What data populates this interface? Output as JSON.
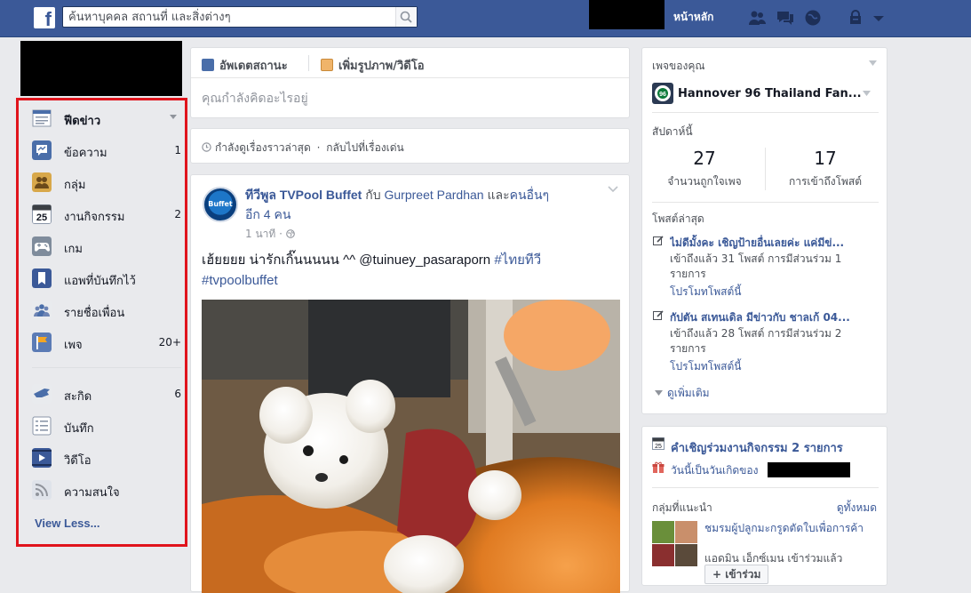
{
  "header": {
    "logo": "f",
    "search_placeholder": "ค้นหาบุคคล สถานที่ และสิ่งต่างๆ",
    "home_label": "หน้าหลัก",
    "icons": [
      "friend-requests-icon",
      "messages-icon",
      "notifications-icon",
      "privacy-icon",
      "account-menu-icon"
    ]
  },
  "sidebar": {
    "items": [
      {
        "label": "ฟีดข่าว",
        "count": "",
        "icon": "news-feed-icon",
        "color": "#ffffff"
      },
      {
        "label": "ข้อความ",
        "count": "1",
        "icon": "messages-icon",
        "color": "#4a6ea9"
      },
      {
        "label": "กลุ่ม",
        "count": "",
        "icon": "groups-icon",
        "color": "#d8a84a"
      },
      {
        "label": "งานกิจกรรม",
        "count": "2",
        "icon": "events-calendar-icon",
        "color": "#ffffff"
      },
      {
        "label": "เกม",
        "count": "",
        "icon": "games-icon",
        "color": "#7f8c9c"
      },
      {
        "label": "แอพที่บันทึกไว้",
        "count": "",
        "icon": "saved-bookmark-icon",
        "color": "#3b5998"
      },
      {
        "label": "รายชื่อเพื่อน",
        "count": "",
        "icon": "friend-lists-icon",
        "color": "#6d84b4"
      },
      {
        "label": "เพจ",
        "count": "20+",
        "icon": "pages-flag-icon",
        "color": "#5b7bb5"
      },
      {
        "label": "สะกิด",
        "count": "6",
        "icon": "pokes-icon",
        "color": "#5b7bb5"
      },
      {
        "label": "บันทึก",
        "count": "",
        "icon": "notes-icon",
        "color": "#e9ebee"
      },
      {
        "label": "วิดีโอ",
        "count": "",
        "icon": "video-icon",
        "color": "#3b5998"
      },
      {
        "label": "ความสนใจ",
        "count": "",
        "icon": "interests-rss-icon",
        "color": "#90949c"
      }
    ],
    "view_less": "View Less..."
  },
  "composer": {
    "tab_status": "อัพเดตสถานะ",
    "tab_photo": "เพิ่มรูปภาพ/วิดีโอ",
    "placeholder": "คุณกำลังคิดอะไรอยู่"
  },
  "story_bar": {
    "text": "กำลังดูเรื่องราวล่าสุด",
    "separator": "·",
    "link": "กลับไปที่เรื่องเด่น"
  },
  "post": {
    "avatar_text": "Buffet",
    "author": "ทีวีพูล TVPool Buffet",
    "with_text": "กับ",
    "tagged": "Gurpreet Pardhan",
    "and_others_prefix": "และ",
    "others_link": "คนอื่นๆ",
    "others_count": "อีก 4 คน",
    "time": "1 นาที",
    "text_main": "เฮ้ยยยย น่ารักเกิ๊นนนนน ^^ @tuinuey_pasaraporn",
    "tag1": "#ไทยทีวี",
    "tag2": "#tvpoolbuffet"
  },
  "right_panel": {
    "your_pages_title": "เพจของคุณ",
    "page_name": "Hannover 96 Thailand Fan...",
    "this_week_title": "สัปดาห์นี้",
    "stats": [
      {
        "value": "27",
        "label": "จำนวนถูกใจเพจ"
      },
      {
        "value": "17",
        "label": "การเข้าถึงโพสต์"
      }
    ],
    "recent_posts_title": "โพสต์ล่าสุด",
    "recent_posts": [
      {
        "title": "ไม่ดีมั้งคะ เชิญป้ายอื่นเลยค่ะ แค่มีข่...",
        "meta": "เข้าถึงแล้ว 31 โพสต์ การมีส่วนร่วม 1 รายการ",
        "promote": "โปรโมทโพสต์นี้"
      },
      {
        "title": "กัปตัน สเทนเดิล มีข่าวกับ ชาลเก้ 04...",
        "meta": "เข้าถึงแล้ว 28 โพสต์ การมีส่วนร่วม 2 รายการ",
        "promote": "โปรโมทโพสต์นี้"
      }
    ],
    "see_more": "ดูเพิ่มเติม"
  },
  "events": {
    "invite_link": "คำเชิญร่วมงานกิจกรรม 2 รายการ",
    "birthday_prefix": "วันนี้เป็นวันเกิดของ",
    "suggested_groups_title": "กลุ่มที่แนะนำ",
    "see_all": "ดูทั้งหมด",
    "group_name": "ชมรมผู้ปลูกมะกรูดตัดใบเพื่อการค้า",
    "group_meta": "แอดมิน เอ็กซ์เมน เข้าร่วมแล้ว",
    "join_label": "+ เข้าร่วม"
  }
}
